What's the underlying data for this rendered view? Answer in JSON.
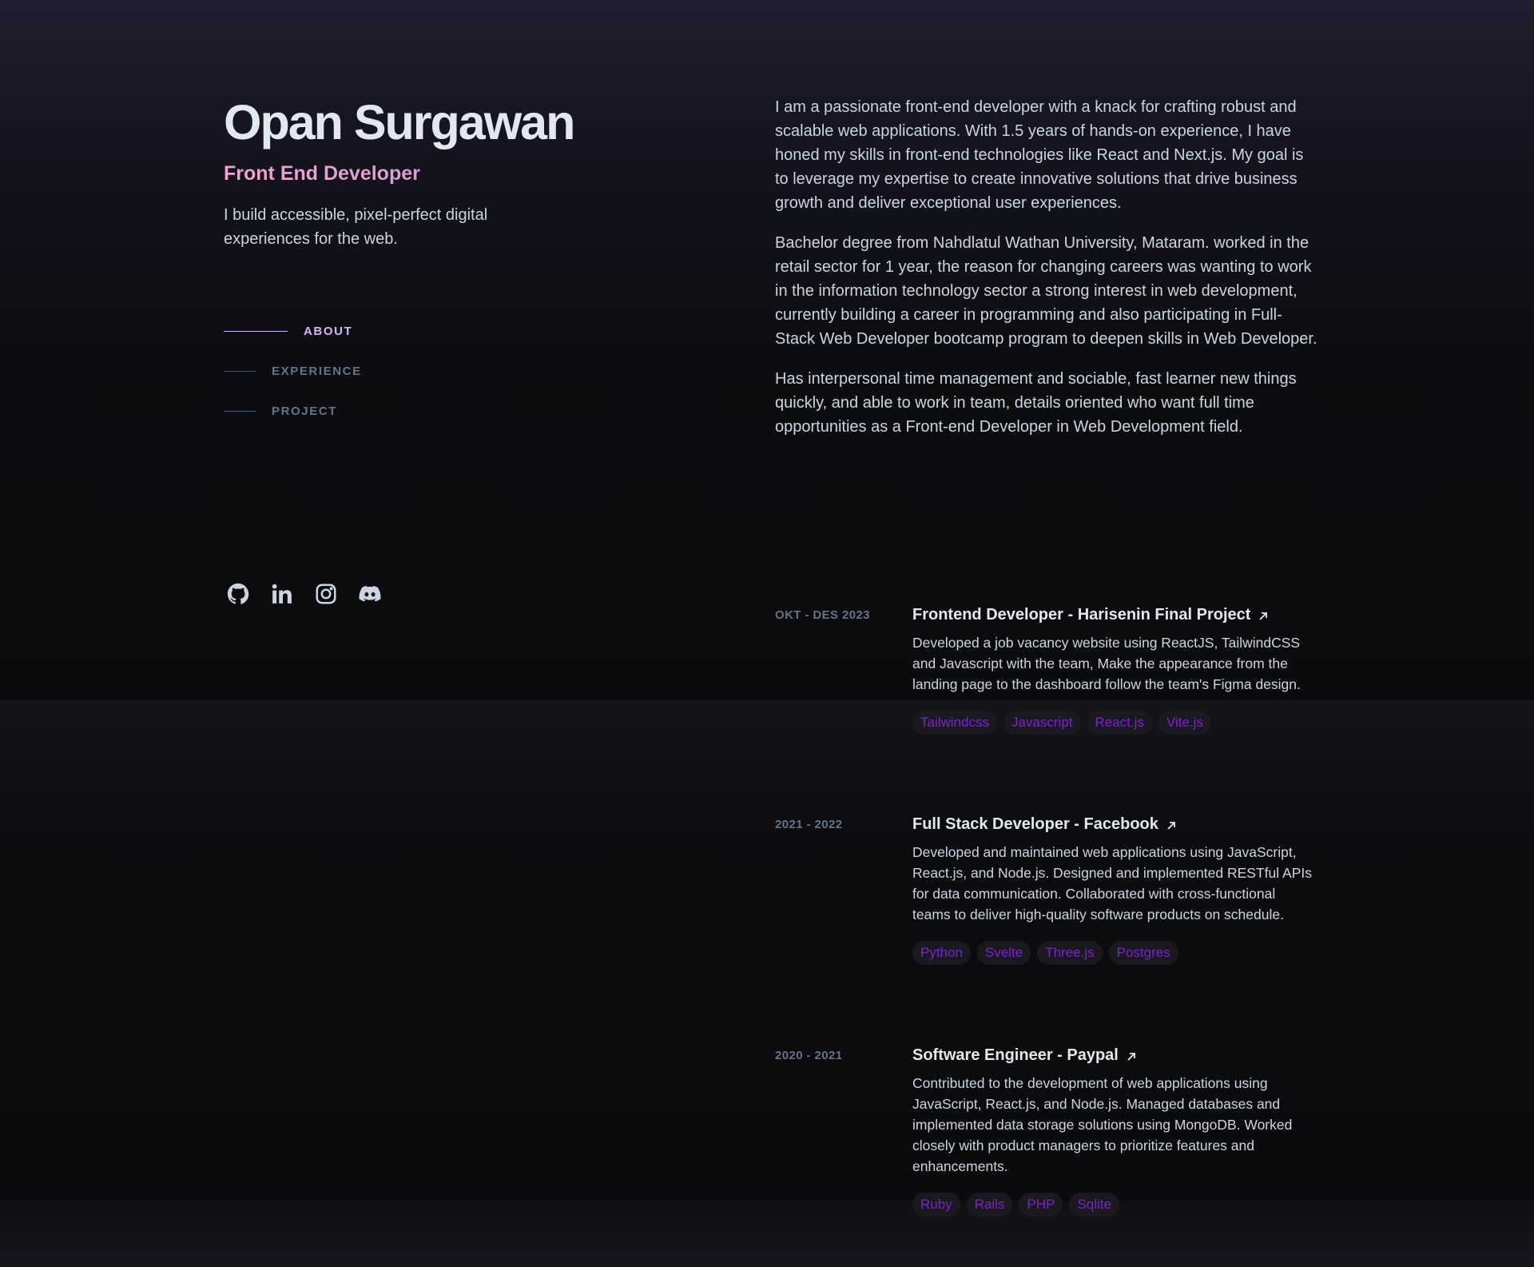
{
  "profile": {
    "name": "Opan Surgawan",
    "role": "Front End Developer",
    "tagline": "I build accessible, pixel-perfect digital experiences for the web."
  },
  "nav": [
    {
      "label": "ABOUT",
      "active": true
    },
    {
      "label": "EXPERIENCE",
      "active": false
    },
    {
      "label": "PROJECT",
      "active": false
    }
  ],
  "socials": [
    {
      "icon": "github-icon"
    },
    {
      "icon": "linkedin-icon"
    },
    {
      "icon": "instagram-icon"
    },
    {
      "icon": "discord-icon"
    }
  ],
  "about": {
    "paragraphs": [
      "I am a passionate front-end developer with a knack for crafting robust and scalable web applications. With 1.5 years of hands-on experience, I have honed my skills in front-end technologies like React and Next.js. My goal is to leverage my expertise to create innovative solutions that drive business growth and deliver exceptional user experiences.",
      "Bachelor degree from Nahdlatul Wathan University, Mataram. worked in the retail sector for 1 year, the reason for changing careers was wanting to work in the information technology sector a strong interest in web development, currently building a career in programming and also participating in Full-Stack Web Developer bootcamp program to deepen skills in Web Developer.",
      "Has interpersonal time management and sociable, fast learner new things quickly, and able to work in team, details oriented who want full time opportunities as a Front-end Developer in Web Development field."
    ]
  },
  "experience": [
    {
      "date": "OKT - DES 2023",
      "title": "Frontend Developer - Harisenin Final Project",
      "description": "Developed a job vacancy website using ReactJS, TailwindCSS and Javascript with the team, Make the appearance from the landing page to the dashboard follow the team's Figma design.",
      "tags": [
        "Tailwindcss",
        "Javascript",
        "React.js",
        "Vite.js"
      ]
    },
    {
      "date": "2021 - 2022",
      "title": "Full Stack Developer - Facebook",
      "description": "Developed and maintained web applications using JavaScript, React.js, and Node.js. Designed and implemented RESTful APIs for data communication. Collaborated with cross-functional teams to deliver high-quality software products on schedule.",
      "tags": [
        "Python",
        "Svelte",
        "Three.js",
        "Postgres"
      ]
    },
    {
      "date": "2020 - 2021",
      "title": "Software Engineer - Paypal",
      "description": "Contributed to the development of web applications using JavaScript, React.js, and Node.js. Managed databases and implemented data storage solutions using MongoDB. Worked closely with product managers to prioritize features and enhancements.",
      "tags": [
        "Ruby",
        "Rails",
        "PHP",
        "Sqlite"
      ]
    }
  ],
  "colors": {
    "accent": "#d8b4fe",
    "tag_text": "#7e22ce",
    "muted": "#64748b",
    "heading": "#e2e8f0"
  }
}
